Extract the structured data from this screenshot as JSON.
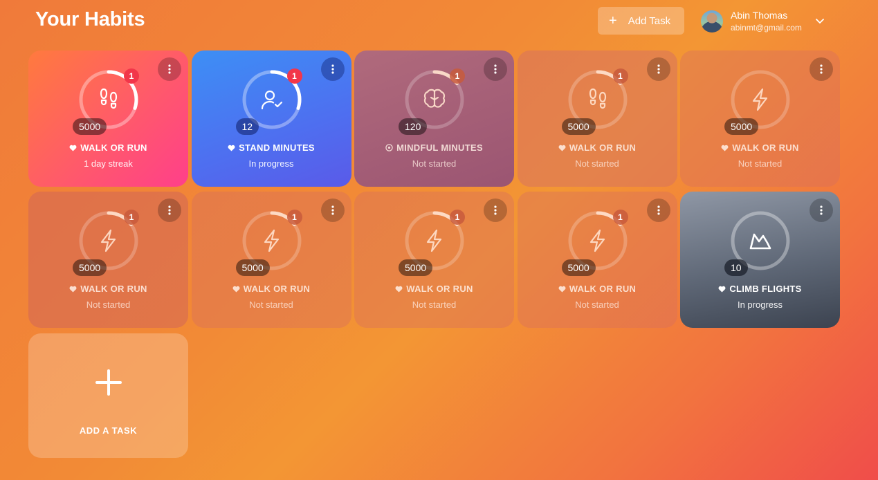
{
  "header": {
    "title": "Your Habits",
    "add_task_label": "Add Task",
    "user": {
      "name": "Abin Thomas",
      "email": "abinmt@gmail.com"
    }
  },
  "cards": [
    {
      "style": "pink",
      "icon": "footprints-icon",
      "badge": "1",
      "badge_style": "red",
      "count": "5000",
      "label": "WALK OR RUN",
      "label_icon": "heart-icon",
      "status": "1 day streak",
      "progress": 0.3
    },
    {
      "style": "blue",
      "icon": "user-check-icon",
      "badge": "1",
      "badge_style": "red",
      "count": "12",
      "label": "STAND MINUTES",
      "label_icon": "heart-icon",
      "status": "In progress",
      "progress": 0.3
    },
    {
      "style": "faded-purple",
      "icon": "brain-icon",
      "badge": "1",
      "badge_style": "dim",
      "count": "120",
      "label": "MINDFUL MINUTES",
      "label_icon": "target-icon",
      "status": "Not started",
      "progress": 0.15
    },
    {
      "style": "faded-orange",
      "icon": "footprints-icon",
      "badge": "1",
      "badge_style": "dim",
      "count": "5000",
      "label": "WALK OR RUN",
      "label_icon": "heart-icon",
      "status": "Not started",
      "progress": 0.15
    },
    {
      "style": "faded-light",
      "icon": "bolt-icon",
      "badge": "",
      "badge_style": "",
      "count": "5000",
      "label": "WALK OR RUN",
      "label_icon": "heart-icon",
      "status": "Not started",
      "progress": 0
    },
    {
      "style": "faded",
      "icon": "bolt-icon",
      "badge": "1",
      "badge_style": "dim",
      "count": "5000",
      "label": "WALK OR RUN",
      "label_icon": "heart-icon",
      "status": "Not started",
      "progress": 0.15
    },
    {
      "style": "faded-light",
      "icon": "bolt-icon",
      "badge": "1",
      "badge_style": "dim",
      "count": "5000",
      "label": "WALK OR RUN",
      "label_icon": "heart-icon",
      "status": "Not started",
      "progress": 0.15
    },
    {
      "style": "faded-light",
      "icon": "bolt-icon",
      "badge": "1",
      "badge_style": "dim",
      "count": "5000",
      "label": "WALK OR RUN",
      "label_icon": "heart-icon",
      "status": "Not started",
      "progress": 0.15
    },
    {
      "style": "faded-light",
      "icon": "bolt-icon",
      "badge": "1",
      "badge_style": "dim",
      "count": "5000",
      "label": "WALK OR RUN",
      "label_icon": "heart-icon",
      "status": "Not started",
      "progress": 0.15
    },
    {
      "style": "slate",
      "icon": "mountain-icon",
      "badge": "",
      "badge_style": "",
      "count": "10",
      "label": "CLIMB FLIGHTS",
      "label_icon": "heart-icon",
      "status": "In progress",
      "progress": 0
    }
  ],
  "add_card": {
    "label": "ADD A TASK"
  }
}
